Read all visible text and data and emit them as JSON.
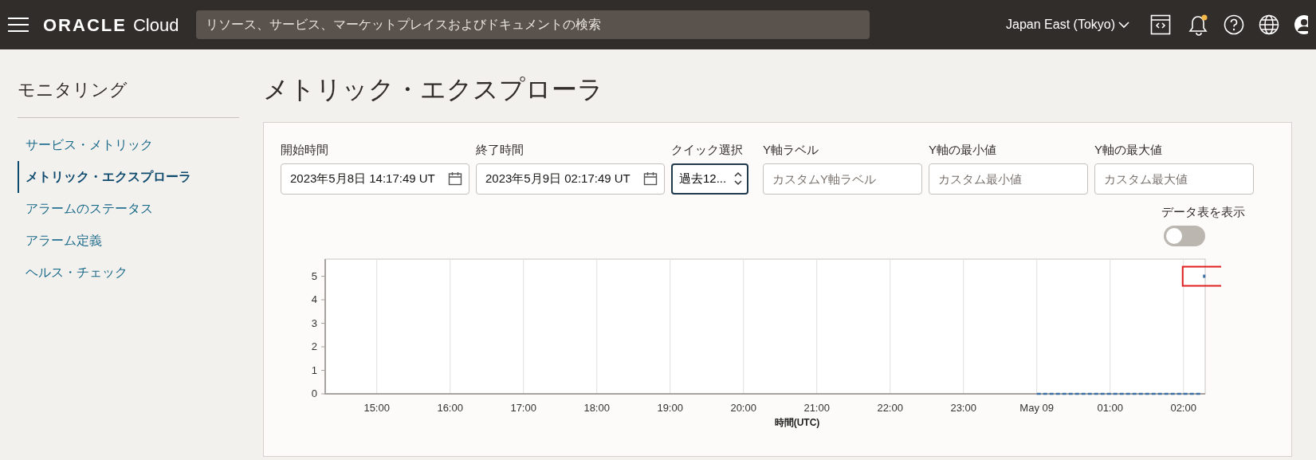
{
  "header": {
    "brand": "ORACLE",
    "product": "Cloud",
    "search": {
      "placeholder": "リソース、サービス、マーケットプレイスおよびドキュメントの検索"
    },
    "region": "Japan East (Tokyo)",
    "notifications_unread": true
  },
  "sidebar": {
    "title": "モニタリング",
    "items": [
      {
        "label": "サービス・メトリック",
        "selected": false
      },
      {
        "label": "メトリック・エクスプローラ",
        "selected": true
      },
      {
        "label": "アラームのステータス",
        "selected": false
      },
      {
        "label": "アラーム定義",
        "selected": false
      },
      {
        "label": "ヘルス・チェック",
        "selected": false
      }
    ]
  },
  "page_title": "メトリック・エクスプローラ",
  "form": {
    "start_time": {
      "label": "開始時間",
      "value": "2023年5月8日 14:17:49 UT"
    },
    "end_time": {
      "label": "終了時間",
      "value": "2023年5月9日 02:17:49 UT"
    },
    "quick_select": {
      "label": "クイック選択",
      "value": "過去12..."
    },
    "y_axis_label": {
      "label": "Y軸ラベル",
      "placeholder": "カスタムY軸ラベル"
    },
    "y_axis_min": {
      "label": "Y軸の最小値",
      "placeholder": "カスタム最小値"
    },
    "y_axis_max": {
      "label": "Y軸の最大値",
      "placeholder": "カスタム最大値"
    }
  },
  "data_table_toggle": {
    "label": "データ表を表示",
    "on": false
  },
  "chart": {
    "chart_data": {
      "type": "line",
      "xlabel": "時間(UTC)",
      "grid": true,
      "x": [
        "2023-05-09T00:00",
        "2023-05-09T00:30",
        "2023-05-09T01:00",
        "2023-05-09T01:30",
        "2023-05-09T02:00",
        "2023-05-09T02:15",
        "2023-05-09T02:17"
      ],
      "series": [
        {
          "color": "#3d6fa6",
          "line_style": "dashed",
          "values": [
            0,
            0,
            0,
            0,
            0,
            0,
            null
          ]
        },
        {
          "color": "#3d6fa6",
          "marker": "square",
          "values": [
            null,
            null,
            null,
            null,
            null,
            null,
            5
          ]
        }
      ],
      "xlim": [
        "2023-05-08T14:17:49",
        "2023-05-09T02:17:49"
      ],
      "ylim": [
        0,
        5.73
      ],
      "xticks": [
        {
          "value": "2023-05-08T15:00",
          "label": "15:00"
        },
        {
          "value": "2023-05-08T16:00",
          "label": "16:00"
        },
        {
          "value": "2023-05-08T17:00",
          "label": "17:00"
        },
        {
          "value": "2023-05-08T18:00",
          "label": "18:00"
        },
        {
          "value": "2023-05-08T19:00",
          "label": "19:00"
        },
        {
          "value": "2023-05-08T20:00",
          "label": "20:00"
        },
        {
          "value": "2023-05-08T21:00",
          "label": "21:00"
        },
        {
          "value": "2023-05-08T22:00",
          "label": "22:00"
        },
        {
          "value": "2023-05-08T23:00",
          "label": "23:00"
        },
        {
          "value": "2023-05-09T00:00",
          "label": "May 09"
        },
        {
          "value": "2023-05-09T01:00",
          "label": "01:00"
        },
        {
          "value": "2023-05-09T02:00",
          "label": "02:00"
        }
      ],
      "yticks": [
        0,
        1,
        2,
        3,
        4,
        5
      ]
    }
  }
}
